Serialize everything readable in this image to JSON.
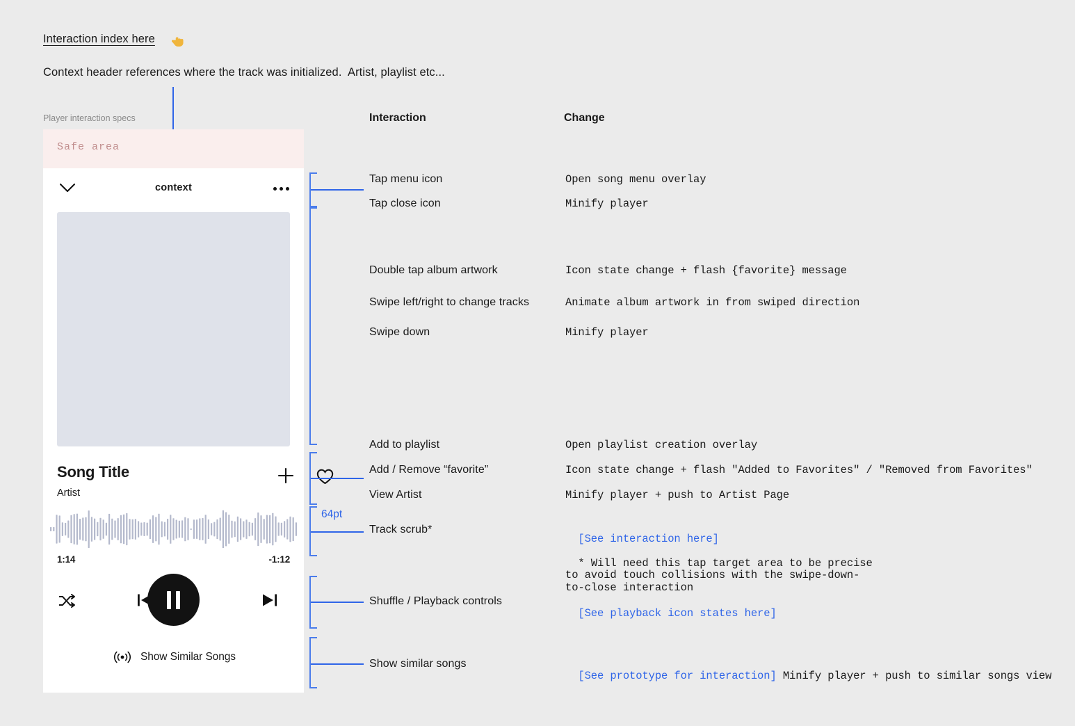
{
  "page": {
    "top_link": "Interaction index here",
    "hand_icon": "pointing-hand-icon",
    "context_note": "Context header references where the track was initialized.  Artist, playlist etc...",
    "accent_blue": "#2f65e8",
    "background": "#ebebeb"
  },
  "player": {
    "caption": "Player interaction specs",
    "safe_area_label": "Safe area",
    "safe_area_color": "#faeeed",
    "header": {
      "close_icon": "chevron-down-icon",
      "context_label": "context",
      "menu_icon": "ellipsis-icon"
    },
    "artwork": {
      "name": "album-artwork",
      "color": "#dfe2ea"
    },
    "song_title": "Song Title",
    "artist": "Artist",
    "add_icon": "plus-icon",
    "favorite_icon": "heart-outline-icon",
    "scrub": {
      "elapsed": "1:14",
      "remaining": "-1:12",
      "waveform_color": "#b4b9cc"
    },
    "controls": {
      "shuffle_icon": "shuffle-icon",
      "previous_icon": "skip-previous-icon",
      "play_pause_icon": "pause-icon",
      "next_icon": "skip-next-icon"
    },
    "similar": {
      "icon": "broadcast-icon",
      "label": "Show Similar Songs"
    }
  },
  "table": {
    "headers": {
      "interaction": "Interaction",
      "change": "Change"
    },
    "measurement": "64pt",
    "rows": [
      {
        "interaction": "Tap menu icon",
        "change": "Open song menu overlay"
      },
      {
        "interaction": "Tap close icon",
        "change": "Minify player"
      },
      {
        "interaction": "Double tap album artwork",
        "change": "Icon state change + flash {favorite} message"
      },
      {
        "interaction": "Swipe left/right to change tracks",
        "change": "Animate album artwork in from swiped direction"
      },
      {
        "interaction": "Swipe down",
        "change": "Minify player"
      },
      {
        "interaction": "Add to playlist",
        "change": "Open playlist creation overlay"
      },
      {
        "interaction": "Add / Remove “favorite”",
        "change": "Icon state change + flash \"Added to Favorites\" / \"Removed from Favorites\""
      },
      {
        "interaction": "View Artist",
        "change": "Minify player + push to Artist Page"
      },
      {
        "interaction": "Track scrub*",
        "change_link": "[See interaction here]",
        "change_note": "* Will need this tap target area to be precise\nto avoid touch collisions with the swipe-down-\nto-close interaction"
      },
      {
        "interaction": "Shuffle / Playback controls",
        "change_link": "[See playback icon states here]"
      },
      {
        "interaction": "Show similar songs",
        "change_link": "[See prototype for interaction]",
        "change_rest": " Minify player + push to similar songs view"
      }
    ]
  }
}
